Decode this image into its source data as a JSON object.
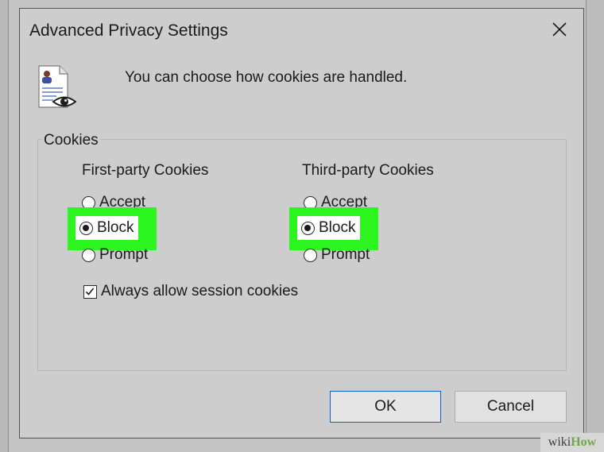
{
  "dialog": {
    "title": "Advanced Privacy Settings",
    "intro": "You can choose how cookies are handled.",
    "header_icon": "privacy-document-eye-icon",
    "close_icon": "close-icon"
  },
  "cookies": {
    "group_label": "Cookies",
    "first_party": {
      "title": "First-party Cookies",
      "options": [
        {
          "label": "Accept",
          "checked": false
        },
        {
          "label": "Block",
          "checked": true
        },
        {
          "label": "Prompt",
          "checked": false
        }
      ]
    },
    "third_party": {
      "title": "Third-party Cookies",
      "options": [
        {
          "label": "Accept",
          "checked": false
        },
        {
          "label": "Block",
          "checked": true
        },
        {
          "label": "Prompt",
          "checked": false
        }
      ]
    },
    "session_cookies": {
      "label": "Always allow session cookies",
      "checked": true
    }
  },
  "buttons": {
    "ok": "OK",
    "cancel": "Cancel"
  },
  "highlight_color": "#2df51f",
  "watermark": {
    "wiki": "wiki",
    "how": "How"
  }
}
